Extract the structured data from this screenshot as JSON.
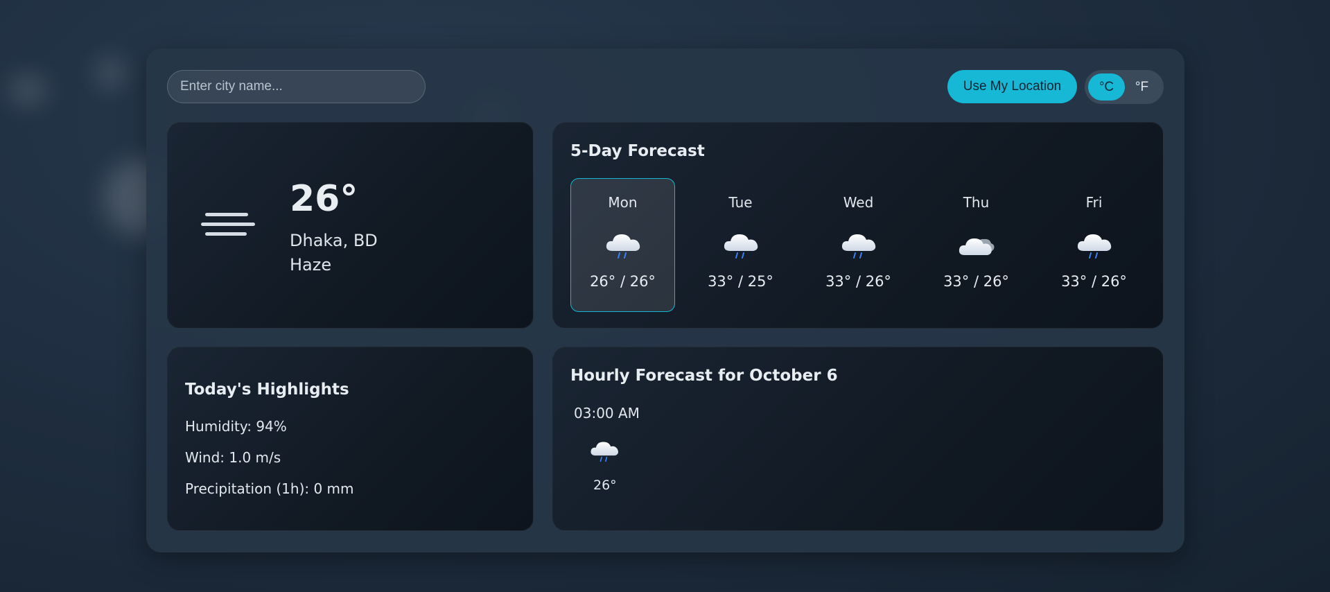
{
  "search": {
    "placeholder": "Enter city name..."
  },
  "controls": {
    "location_label": "Use My Location",
    "unit_c": "°C",
    "unit_f": "°F",
    "active_unit": "°C"
  },
  "current": {
    "temperature": "26°",
    "city": "Dhaka, BD",
    "condition": "Haze",
    "icon": "haze-icon"
  },
  "forecast": {
    "title": "5-Day Forecast",
    "days": [
      {
        "day": "Mon",
        "temps": "26° / 26°",
        "icon": "rain-cloud-icon"
      },
      {
        "day": "Tue",
        "temps": "33° / 25°",
        "icon": "rain-cloud-icon"
      },
      {
        "day": "Wed",
        "temps": "33° / 26°",
        "icon": "rain-cloud-icon"
      },
      {
        "day": "Thu",
        "temps": "33° / 26°",
        "icon": "cloudy-icon"
      },
      {
        "day": "Fri",
        "temps": "33° / 26°",
        "icon": "rain-cloud-icon"
      }
    ]
  },
  "highlights": {
    "title": "Today's Highlights",
    "humidity": "Humidity: 94%",
    "wind": "Wind: 1.0 m/s",
    "precipitation": "Precipitation (1h): 0 mm"
  },
  "hourly": {
    "title": "Hourly Forecast for October 6",
    "items": [
      {
        "time": "03:00 AM",
        "temp": "26°",
        "icon": "rain-cloud-icon"
      }
    ]
  },
  "colors": {
    "accent": "#16b8d6",
    "card_bg": "#111923",
    "panel_bg": "#263648"
  }
}
